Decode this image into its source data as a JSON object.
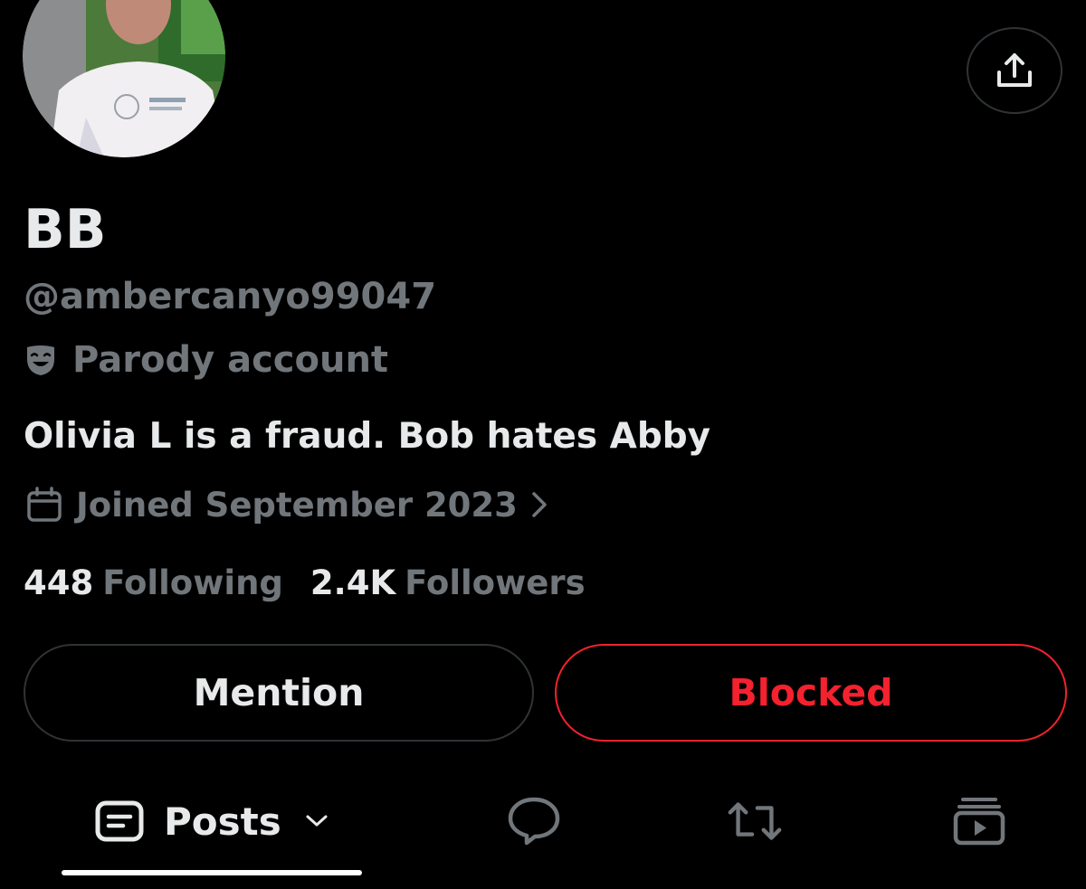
{
  "profile": {
    "display_name": "BB",
    "handle": "@ambercanyo99047",
    "label": "Parody account",
    "bio": "Olivia L is a fraud. Bob hates Abby",
    "joined": "Joined September 2023"
  },
  "stats": {
    "following_count": "448",
    "following_label": "Following",
    "followers_count": "2.4K",
    "followers_label": "Followers"
  },
  "actions": {
    "mention_label": "Mention",
    "blocked_label": "Blocked"
  },
  "tabs": {
    "posts_label": "Posts",
    "active": "Posts"
  },
  "colors": {
    "background": "#000000",
    "text_primary": "#e7e9ea",
    "text_secondary": "#71767b",
    "border": "#2f3336",
    "blocked_red": "#f4212e"
  },
  "icons": {
    "share": "share-icon",
    "parody": "theater-mask-icon",
    "joined": "calendar-icon",
    "joined_more": "chevron-right-icon",
    "posts": "posts-icon",
    "posts_dropdown": "chevron-down-icon",
    "replies": "reply-bubble-icon",
    "reposts": "repost-icon",
    "media": "media-icon"
  }
}
